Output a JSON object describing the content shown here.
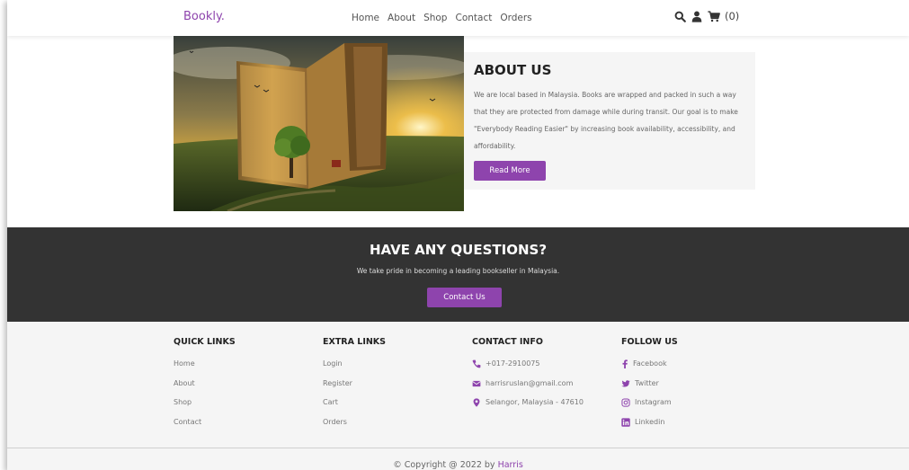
{
  "header": {
    "logo": "Bookly.",
    "nav": [
      "Home",
      "About",
      "Shop",
      "Contact",
      "Orders"
    ],
    "cart_count": "(0)"
  },
  "about": {
    "title": "ABOUT US",
    "text": "We are local based in Malaysia. Books are wrapped and packed in such a way that they are protected from damage while during transit. Our goal is to make \"Everybody Reading Easier\" by increasing book availability, accessibility, and affordability.",
    "button": "Read More"
  },
  "questions": {
    "title": "HAVE ANY QUESTIONS?",
    "subtitle": "We take pride in becoming a leading bookseller in Malaysia.",
    "button": "Contact Us"
  },
  "footer": {
    "quick_links": {
      "title": "QUICK LINKS",
      "items": [
        "Home",
        "About",
        "Shop",
        "Contact"
      ]
    },
    "extra_links": {
      "title": "EXTRA LINKS",
      "items": [
        "Login",
        "Register",
        "Cart",
        "Orders"
      ]
    },
    "contact_info": {
      "title": "CONTACT INFO",
      "items": [
        "+017-2910075",
        "harrisruslan@gmail.com",
        "Selangor, Malaysia - 47610"
      ]
    },
    "follow_us": {
      "title": "FOLLOW US",
      "items": [
        "Facebook",
        "Twitter",
        "Instagram",
        "Linkedin"
      ]
    },
    "copyright_prefix": "© Copyright @ 2022 by ",
    "copyright_author": "Harris"
  },
  "colors": {
    "accent": "#8e44ad",
    "dark_band": "#333333",
    "light_bg": "#f5f5f5"
  }
}
